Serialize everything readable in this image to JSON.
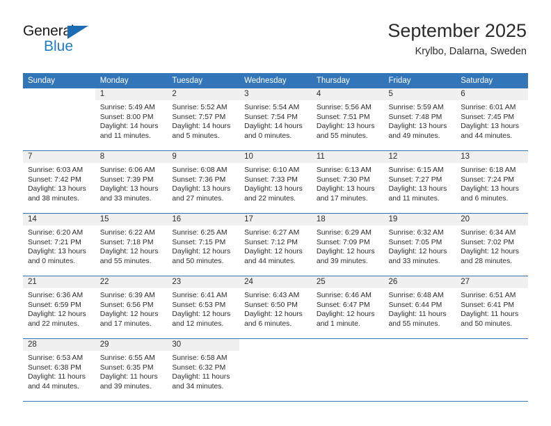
{
  "brand": {
    "name_top": "General",
    "name_bottom": "Blue",
    "accent_color": "#1c7cc4",
    "triangle_color": "#1c6cb5"
  },
  "header": {
    "title": "September 2025",
    "subtitle": "Krylbo, Dalarna, Sweden"
  },
  "calendar": {
    "header_bg": "#3275b8",
    "daynum_bg": "#f0f0f0",
    "weekdays": [
      "Sunday",
      "Monday",
      "Tuesday",
      "Wednesday",
      "Thursday",
      "Friday",
      "Saturday"
    ],
    "weeks": [
      [
        {
          "day": "",
          "sunrise": "",
          "sunset": "",
          "daylight1": "",
          "daylight2": ""
        },
        {
          "day": "1",
          "sunrise": "Sunrise: 5:49 AM",
          "sunset": "Sunset: 8:00 PM",
          "daylight1": "Daylight: 14 hours",
          "daylight2": "and 11 minutes."
        },
        {
          "day": "2",
          "sunrise": "Sunrise: 5:52 AM",
          "sunset": "Sunset: 7:57 PM",
          "daylight1": "Daylight: 14 hours",
          "daylight2": "and 5 minutes."
        },
        {
          "day": "3",
          "sunrise": "Sunrise: 5:54 AM",
          "sunset": "Sunset: 7:54 PM",
          "daylight1": "Daylight: 14 hours",
          "daylight2": "and 0 minutes."
        },
        {
          "day": "4",
          "sunrise": "Sunrise: 5:56 AM",
          "sunset": "Sunset: 7:51 PM",
          "daylight1": "Daylight: 13 hours",
          "daylight2": "and 55 minutes."
        },
        {
          "day": "5",
          "sunrise": "Sunrise: 5:59 AM",
          "sunset": "Sunset: 7:48 PM",
          "daylight1": "Daylight: 13 hours",
          "daylight2": "and 49 minutes."
        },
        {
          "day": "6",
          "sunrise": "Sunrise: 6:01 AM",
          "sunset": "Sunset: 7:45 PM",
          "daylight1": "Daylight: 13 hours",
          "daylight2": "and 44 minutes."
        }
      ],
      [
        {
          "day": "7",
          "sunrise": "Sunrise: 6:03 AM",
          "sunset": "Sunset: 7:42 PM",
          "daylight1": "Daylight: 13 hours",
          "daylight2": "and 38 minutes."
        },
        {
          "day": "8",
          "sunrise": "Sunrise: 6:06 AM",
          "sunset": "Sunset: 7:39 PM",
          "daylight1": "Daylight: 13 hours",
          "daylight2": "and 33 minutes."
        },
        {
          "day": "9",
          "sunrise": "Sunrise: 6:08 AM",
          "sunset": "Sunset: 7:36 PM",
          "daylight1": "Daylight: 13 hours",
          "daylight2": "and 27 minutes."
        },
        {
          "day": "10",
          "sunrise": "Sunrise: 6:10 AM",
          "sunset": "Sunset: 7:33 PM",
          "daylight1": "Daylight: 13 hours",
          "daylight2": "and 22 minutes."
        },
        {
          "day": "11",
          "sunrise": "Sunrise: 6:13 AM",
          "sunset": "Sunset: 7:30 PM",
          "daylight1": "Daylight: 13 hours",
          "daylight2": "and 17 minutes."
        },
        {
          "day": "12",
          "sunrise": "Sunrise: 6:15 AM",
          "sunset": "Sunset: 7:27 PM",
          "daylight1": "Daylight: 13 hours",
          "daylight2": "and 11 minutes."
        },
        {
          "day": "13",
          "sunrise": "Sunrise: 6:18 AM",
          "sunset": "Sunset: 7:24 PM",
          "daylight1": "Daylight: 13 hours",
          "daylight2": "and 6 minutes."
        }
      ],
      [
        {
          "day": "14",
          "sunrise": "Sunrise: 6:20 AM",
          "sunset": "Sunset: 7:21 PM",
          "daylight1": "Daylight: 13 hours",
          "daylight2": "and 0 minutes."
        },
        {
          "day": "15",
          "sunrise": "Sunrise: 6:22 AM",
          "sunset": "Sunset: 7:18 PM",
          "daylight1": "Daylight: 12 hours",
          "daylight2": "and 55 minutes."
        },
        {
          "day": "16",
          "sunrise": "Sunrise: 6:25 AM",
          "sunset": "Sunset: 7:15 PM",
          "daylight1": "Daylight: 12 hours",
          "daylight2": "and 50 minutes."
        },
        {
          "day": "17",
          "sunrise": "Sunrise: 6:27 AM",
          "sunset": "Sunset: 7:12 PM",
          "daylight1": "Daylight: 12 hours",
          "daylight2": "and 44 minutes."
        },
        {
          "day": "18",
          "sunrise": "Sunrise: 6:29 AM",
          "sunset": "Sunset: 7:09 PM",
          "daylight1": "Daylight: 12 hours",
          "daylight2": "and 39 minutes."
        },
        {
          "day": "19",
          "sunrise": "Sunrise: 6:32 AM",
          "sunset": "Sunset: 7:05 PM",
          "daylight1": "Daylight: 12 hours",
          "daylight2": "and 33 minutes."
        },
        {
          "day": "20",
          "sunrise": "Sunrise: 6:34 AM",
          "sunset": "Sunset: 7:02 PM",
          "daylight1": "Daylight: 12 hours",
          "daylight2": "and 28 minutes."
        }
      ],
      [
        {
          "day": "21",
          "sunrise": "Sunrise: 6:36 AM",
          "sunset": "Sunset: 6:59 PM",
          "daylight1": "Daylight: 12 hours",
          "daylight2": "and 22 minutes."
        },
        {
          "day": "22",
          "sunrise": "Sunrise: 6:39 AM",
          "sunset": "Sunset: 6:56 PM",
          "daylight1": "Daylight: 12 hours",
          "daylight2": "and 17 minutes."
        },
        {
          "day": "23",
          "sunrise": "Sunrise: 6:41 AM",
          "sunset": "Sunset: 6:53 PM",
          "daylight1": "Daylight: 12 hours",
          "daylight2": "and 12 minutes."
        },
        {
          "day": "24",
          "sunrise": "Sunrise: 6:43 AM",
          "sunset": "Sunset: 6:50 PM",
          "daylight1": "Daylight: 12 hours",
          "daylight2": "and 6 minutes."
        },
        {
          "day": "25",
          "sunrise": "Sunrise: 6:46 AM",
          "sunset": "Sunset: 6:47 PM",
          "daylight1": "Daylight: 12 hours",
          "daylight2": "and 1 minute."
        },
        {
          "day": "26",
          "sunrise": "Sunrise: 6:48 AM",
          "sunset": "Sunset: 6:44 PM",
          "daylight1": "Daylight: 11 hours",
          "daylight2": "and 55 minutes."
        },
        {
          "day": "27",
          "sunrise": "Sunrise: 6:51 AM",
          "sunset": "Sunset: 6:41 PM",
          "daylight1": "Daylight: 11 hours",
          "daylight2": "and 50 minutes."
        }
      ],
      [
        {
          "day": "28",
          "sunrise": "Sunrise: 6:53 AM",
          "sunset": "Sunset: 6:38 PM",
          "daylight1": "Daylight: 11 hours",
          "daylight2": "and 44 minutes."
        },
        {
          "day": "29",
          "sunrise": "Sunrise: 6:55 AM",
          "sunset": "Sunset: 6:35 PM",
          "daylight1": "Daylight: 11 hours",
          "daylight2": "and 39 minutes."
        },
        {
          "day": "30",
          "sunrise": "Sunrise: 6:58 AM",
          "sunset": "Sunset: 6:32 PM",
          "daylight1": "Daylight: 11 hours",
          "daylight2": "and 34 minutes."
        },
        {
          "day": "",
          "sunrise": "",
          "sunset": "",
          "daylight1": "",
          "daylight2": ""
        },
        {
          "day": "",
          "sunrise": "",
          "sunset": "",
          "daylight1": "",
          "daylight2": ""
        },
        {
          "day": "",
          "sunrise": "",
          "sunset": "",
          "daylight1": "",
          "daylight2": ""
        },
        {
          "day": "",
          "sunrise": "",
          "sunset": "",
          "daylight1": "",
          "daylight2": ""
        }
      ]
    ]
  }
}
